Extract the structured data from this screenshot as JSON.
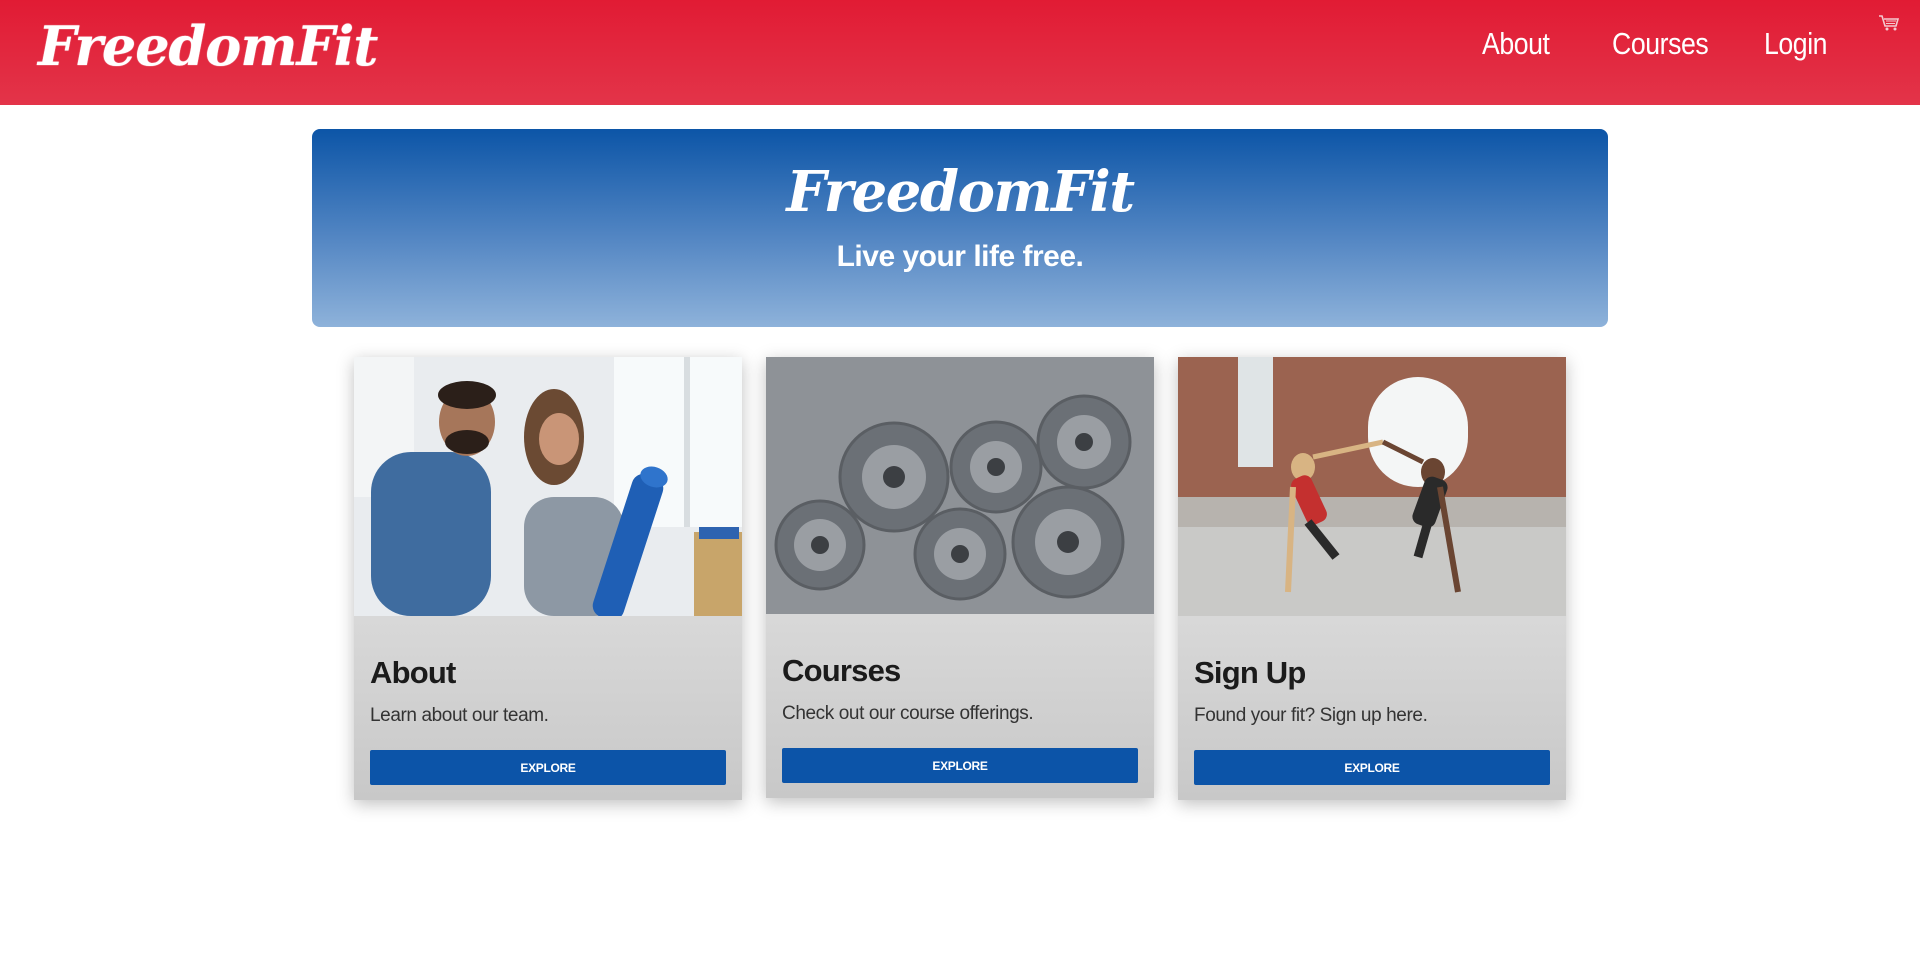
{
  "navbar": {
    "brand": "FreedomFit",
    "links": [
      "About",
      "Courses",
      "Login"
    ],
    "cart_icon": "cart-icon",
    "background": "#e11b34"
  },
  "hero": {
    "title": "FreedomFit",
    "tagline": "Live your life free.",
    "gradient_top": "#0c55a7",
    "gradient_bottom": "#8eb2da"
  },
  "cards": [
    {
      "title": "About",
      "text": "Learn about our team.",
      "button": "EXPLORE",
      "image": "couple-with-yoga-mat-photo"
    },
    {
      "title": "Courses",
      "text": "Check out our course offerings.",
      "button": "EXPLORE",
      "image": "weight-plates-photo"
    },
    {
      "title": "Sign Up",
      "text": "Found your fit? Sign up here.",
      "button": "EXPLORE",
      "image": "women-high-five-plank-photo"
    }
  ],
  "colors": {
    "accent_red": "#e11b34",
    "button_blue": "#0c54a8"
  }
}
